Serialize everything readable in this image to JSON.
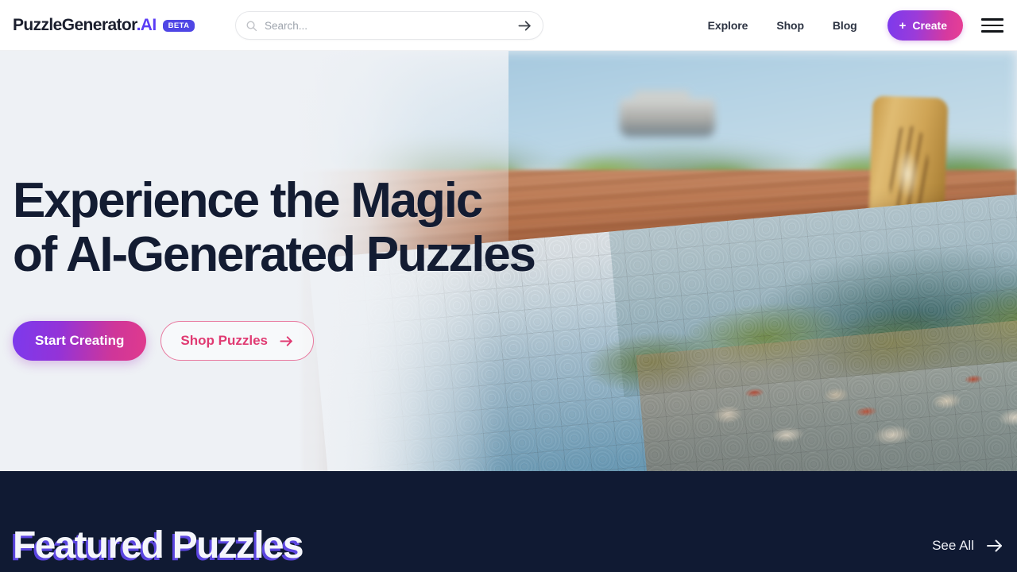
{
  "header": {
    "logo": {
      "name": "PuzzleGenerator",
      "suffix": ".AI",
      "badge": "BETA"
    },
    "search": {
      "placeholder": "Search...",
      "value": "",
      "submit_icon": "arrow-right-icon"
    },
    "nav": [
      {
        "label": "Explore"
      },
      {
        "label": "Shop"
      },
      {
        "label": "Blog"
      }
    ],
    "create_button": {
      "label": "Create",
      "icon": "plus-icon"
    },
    "menu_icon": "hamburger-menu-icon"
  },
  "hero": {
    "title_line1": "Experience the Magic",
    "title_line2": "of AI-Generated Puzzles",
    "primary_cta": "Start Creating",
    "secondary_cta": "Shop Puzzles",
    "secondary_cta_icon": "arrow-right-icon",
    "image_alt": "Assembled jigsaw puzzle of a coastal town on a wooden table"
  },
  "featured": {
    "title": "Featured Puzzles",
    "see_all": "See All",
    "see_all_icon": "arrow-right-icon"
  },
  "colors": {
    "brand_purple": "#5b3df5",
    "brand_pink": "#e03a8d",
    "badge_indigo": "#4f46e5",
    "dark_navy": "#101a33",
    "hero_bg": "#eef1f5",
    "title_navy": "#131c32"
  }
}
